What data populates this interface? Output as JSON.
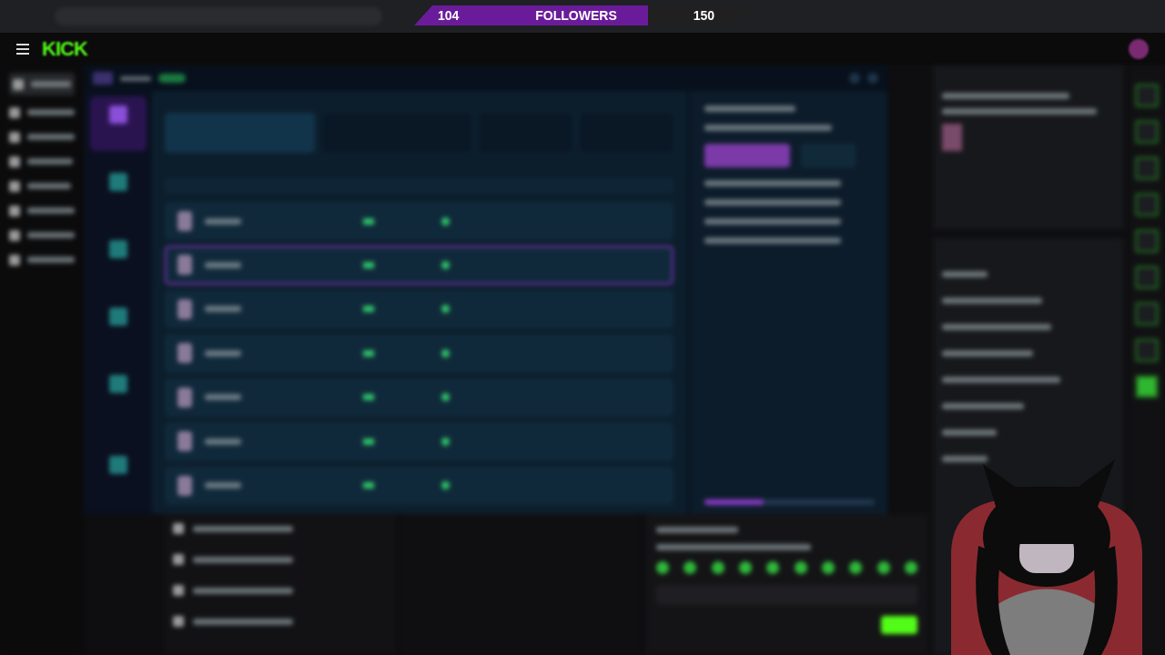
{
  "follower_goal": {
    "current": "104",
    "label": "FOLLOWERS",
    "goal": "150",
    "level": 0.69
  },
  "header": {
    "logo": "KICK"
  },
  "checklist": {
    "level": 0.35
  },
  "tracker_rows": [
    {
      "selected": false
    },
    {
      "selected": true
    },
    {
      "selected": false
    },
    {
      "selected": false
    },
    {
      "selected": false
    },
    {
      "selected": false
    },
    {
      "selected": false
    }
  ]
}
